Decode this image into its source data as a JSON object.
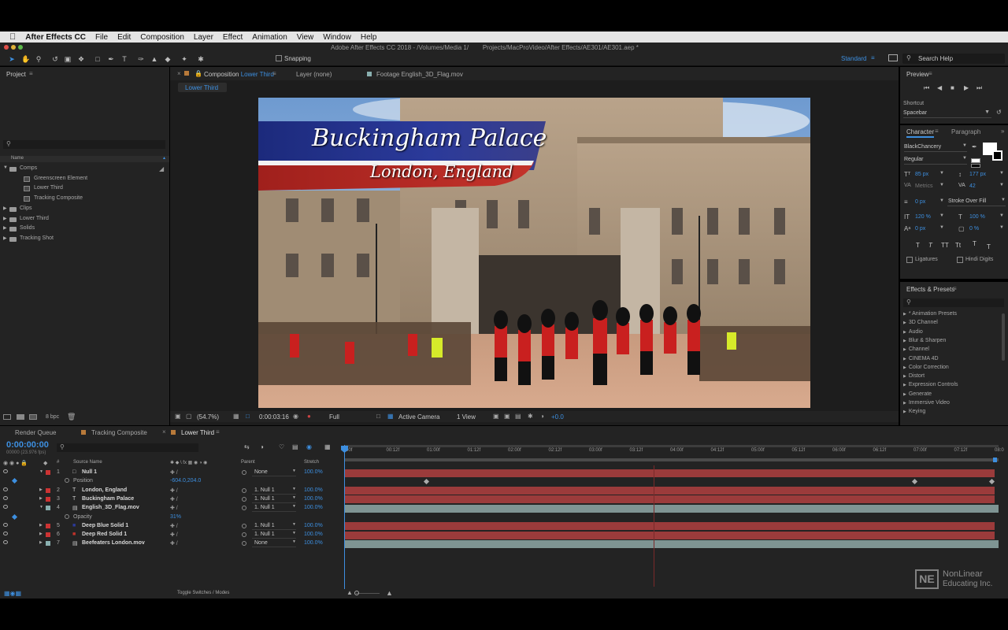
{
  "menubar": {
    "app": "After Effects CC",
    "items": [
      "File",
      "Edit",
      "Composition",
      "Layer",
      "Effect",
      "Animation",
      "View",
      "Window",
      "Help"
    ]
  },
  "title": "Adobe After Effects CC 2018 - /Volumes/Media 1/        Projects/MacProVideo/After Effects/AE301/AE301.aep *",
  "toolbar": {
    "snapping": "Snapping",
    "workspace": "Standard",
    "search_help": "Search Help"
  },
  "project": {
    "title": "Project",
    "col_name": "Name",
    "bit_depth": "8 bpc",
    "tree": [
      {
        "label": "Comps",
        "type": "folder",
        "indent": 0
      },
      {
        "label": "Greenscreen Element",
        "type": "comp",
        "indent": 1
      },
      {
        "label": "Lower Third",
        "type": "comp",
        "indent": 1
      },
      {
        "label": "Tracking Composite",
        "type": "comp",
        "indent": 1
      },
      {
        "label": "Clips",
        "type": "folder",
        "indent": 0
      },
      {
        "label": "Lower Third",
        "type": "folder",
        "indent": 0
      },
      {
        "label": "Solids",
        "type": "folder",
        "indent": 0
      },
      {
        "label": "Tracking Shot",
        "type": "folder",
        "indent": 0
      }
    ]
  },
  "viewer": {
    "tab_comp_prefix": "Composition",
    "tab_comp_name": "Lower Third",
    "tab_layer": "Layer (none)",
    "tab_footage": "Footage English_3D_Flag.mov",
    "sub_tab": "Lower Third",
    "banner_title": "Buckingham Palace",
    "banner_subtitle": "London, England",
    "zoom": "(54.7%)",
    "timecode": "0:00:03:16",
    "resolution": "Full",
    "camera": "Active Camera",
    "views": "1 View",
    "exposure": "+0.0"
  },
  "preview": {
    "title": "Preview",
    "shortcut_label": "Shortcut",
    "shortcut_value": "Spacebar"
  },
  "character": {
    "tab_character": "Character",
    "tab_paragraph": "Paragraph",
    "font": "BlackChancery",
    "style": "Regular",
    "size": "85 px",
    "leading": "177 px",
    "kerning": "Metrics",
    "tracking": "42",
    "stroke_width": "0 px",
    "stroke_mode": "Stroke Over Fill",
    "vscale": "120 %",
    "hscale": "100 %",
    "baseline": "0 px",
    "tsume": "0 %",
    "ligatures": "Ligatures",
    "hindi": "Hindi Digits",
    "style_buttons": [
      "T",
      "T",
      "TT",
      "Tt",
      "T",
      "T"
    ]
  },
  "effects": {
    "title": "Effects & Presets",
    "items": [
      "* Animation Presets",
      "3D Channel",
      "Audio",
      "Blur & Sharpen",
      "Channel",
      "CINEMA 4D",
      "Color Correction",
      "Distort",
      "Expression Controls",
      "Generate",
      "Immersive Video",
      "Keying"
    ]
  },
  "timeline": {
    "tabs": [
      "Render Queue",
      "Tracking Composite",
      "Lower Third"
    ],
    "timecode": "0:00:00:00",
    "fps": "00000 (23.976 fps)",
    "col_num": "#",
    "col_source": "Source Name",
    "col_parent": "Parent",
    "col_stretch": "Stretch",
    "ruler": [
      "00f",
      "00:12f",
      "01:00f",
      "01:12f",
      "02:00f",
      "02:12f",
      "03:00f",
      "03:12f",
      "04:00f",
      "04:12f",
      "05:00f",
      "05:12f",
      "06:00f",
      "06:12f",
      "07:00f",
      "07:12f",
      "08:0"
    ],
    "layers": [
      {
        "kind": "layer",
        "num": "1",
        "name": "Null 1",
        "parent": "None",
        "stretch": "100.0%",
        "color": "#c33",
        "bar": "#9b3b3b",
        "expanded": true
      },
      {
        "kind": "prop",
        "name": "Position",
        "value": "-604.0,204.0"
      },
      {
        "kind": "layer",
        "num": "2",
        "name": "London, England",
        "parent": "1. Null 1",
        "stretch": "100.0%",
        "color": "#c33",
        "bar": "#9b3b3b"
      },
      {
        "kind": "layer",
        "num": "3",
        "name": "Buckingham Palace",
        "parent": "1. Null 1",
        "stretch": "100.0%",
        "color": "#c33",
        "bar": "#9b3b3b"
      },
      {
        "kind": "layer",
        "num": "4",
        "name": "English_3D_Flag.mov",
        "parent": "1. Null 1",
        "stretch": "100.0%",
        "color": "#8ab0b0",
        "bar": "#7f9493",
        "expanded": true
      },
      {
        "kind": "prop",
        "name": "Opacity",
        "value": "31%"
      },
      {
        "kind": "layer",
        "num": "5",
        "name": "Deep Blue Solid 1",
        "parent": "1. Null 1",
        "stretch": "100.0%",
        "color": "#c33",
        "bar": "#9b3b3b"
      },
      {
        "kind": "layer",
        "num": "6",
        "name": "Deep Red Solid 1",
        "parent": "1. Null 1",
        "stretch": "100.0%",
        "color": "#c33",
        "bar": "#9b3b3b"
      },
      {
        "kind": "layer",
        "num": "7",
        "name": "Beefeaters London.mov",
        "parent": "None",
        "stretch": "100.0%",
        "color": "#8ab0b0",
        "bar": "#7f9493"
      }
    ],
    "toggle": "Toggle Switches / Modes"
  },
  "watermark": {
    "logo": "NE",
    "line1": "NonLinear",
    "line2": "Educating Inc."
  },
  "colors": {
    "accent": "#3d8fe0",
    "panel": "#232323",
    "dark": "#1b1b1b",
    "layer_red": "#9b3b3b",
    "layer_teal": "#7f9493"
  }
}
